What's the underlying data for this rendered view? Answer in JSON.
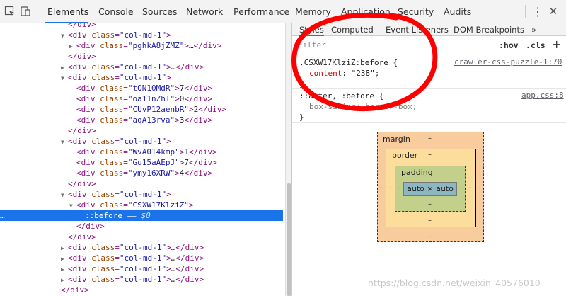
{
  "topbar": {
    "tabs": [
      "Elements",
      "Console",
      "Sources",
      "Network",
      "Performance",
      "Memory",
      "Application",
      "Security",
      "Audits"
    ],
    "kebab": "⋮",
    "close": "✕"
  },
  "dom": {
    "close_div": "</div>",
    "tag_div": "div",
    "attr_class": "class",
    "eq": "=",
    "quote": "\"",
    "ellipsis": "…",
    "cls_col": "col-md-1",
    "cls_pghk": "pghkA8jZMZ",
    "cls_tqn": "tQN10MdR",
    "cls_oa": "oa11nZhT",
    "cls_cuv": "CUvP12aenbR",
    "cls_aqa": "aqA13rva",
    "cls_wva": "WvA014kmp",
    "cls_gu": "Gu15aAEpJ",
    "cls_ymy": "ymy16XRW",
    "cls_csxw": "CSXW17KlziZ",
    "text_7": "7",
    "text_0": "0",
    "text_2": "2",
    "text_3": "3",
    "text_1": "1",
    "text_4": "4",
    "pseudo": "::before",
    "pseudo_eq": "==",
    "pseudo_ref": "$0",
    "dots": "…"
  },
  "styles": {
    "subtabs": [
      "Styles",
      "Computed",
      "Event Listeners",
      "DOM Breakpoints",
      "»"
    ],
    "filter_placeholder": "Filter",
    "hov": ":hov",
    "cls": ".cls",
    "plus": "+",
    "rule1_selector": ".CSXW17KlziZ:before {",
    "rule1_source": "crawler-css-puzzle-1:70",
    "rule1_prop": "content",
    "rule1_colon": ":",
    "rule1_value": "\"238\";",
    "rule_close": "}",
    "rule2_selector": "::after, :before {",
    "rule2_source": "app.css:8",
    "rule2_prop": "box-sizing",
    "rule2_value": "border-box;"
  },
  "boxmodel": {
    "margin": "margin",
    "border": "border",
    "padding": "padding",
    "content": "auto × auto",
    "dash": "–"
  },
  "watermark": "https://blog.csdn.net/weixin_40576010",
  "colors": {
    "accent": "#1a73e8",
    "annotation": "#ff0000"
  }
}
